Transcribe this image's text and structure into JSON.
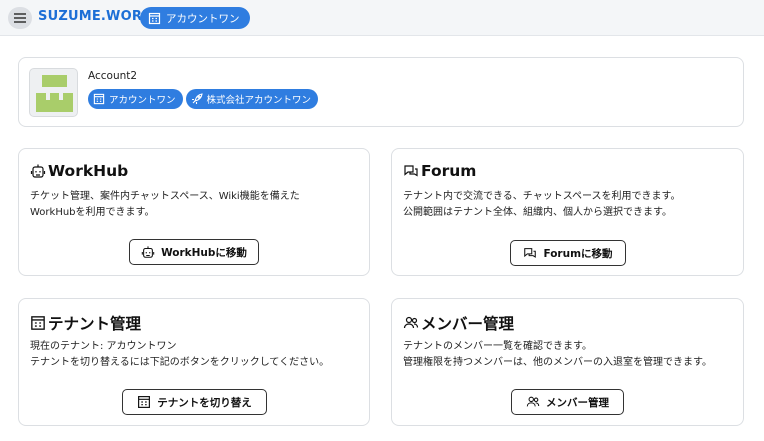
{
  "header": {
    "brand": "SUZUME.WORK",
    "tenant_label": "アカウントワン",
    "icons": {
      "menu": "menu-icon",
      "tenant": "building-icon"
    }
  },
  "account": {
    "name": "Account2",
    "badges": [
      {
        "label": "アカウントワン",
        "icon": "building-icon"
      },
      {
        "label": "株式会社アカウントワン",
        "icon": "rocket-icon"
      }
    ],
    "avatar_colors": {
      "background": "#eef0f2",
      "shape": "#a9cd6a"
    }
  },
  "cards": {
    "workhub": {
      "title": "WorkHub",
      "icon": "robot-icon",
      "description": "チケット管理、案件内チャットスペース、Wiki機能を備えた\nWorkHubを利用できます。",
      "button_label": "WorkHubに移動"
    },
    "forum": {
      "title": "Forum",
      "icon": "chat-bubbles-icon",
      "description": "テナント内で交流できる、チャットスペースを利用できます。\n公開範囲はテナント全体、組織内、個人から選択できます。",
      "button_label": "Forumに移動"
    },
    "tenant": {
      "title": "テナント管理",
      "icon": "building-icon",
      "description": "現在のテナント: アカウントワン\nテナントを切り替えるには下記のボタンをクリックしてください。",
      "button_label": "テナントを切り替え"
    },
    "members": {
      "title": "メンバー管理",
      "icon": "users-icon",
      "description": "テナントのメンバー一覧を確認できます。\n管理権限を持つメンバーは、他のメンバーの入退室を管理できます。",
      "button_label": "メンバー管理"
    }
  },
  "colors": {
    "accent": "#2f7de0",
    "brand_text": "#1d6fd6",
    "header_bg": "#f4f6f8",
    "card_border": "#dcdfe3"
  }
}
